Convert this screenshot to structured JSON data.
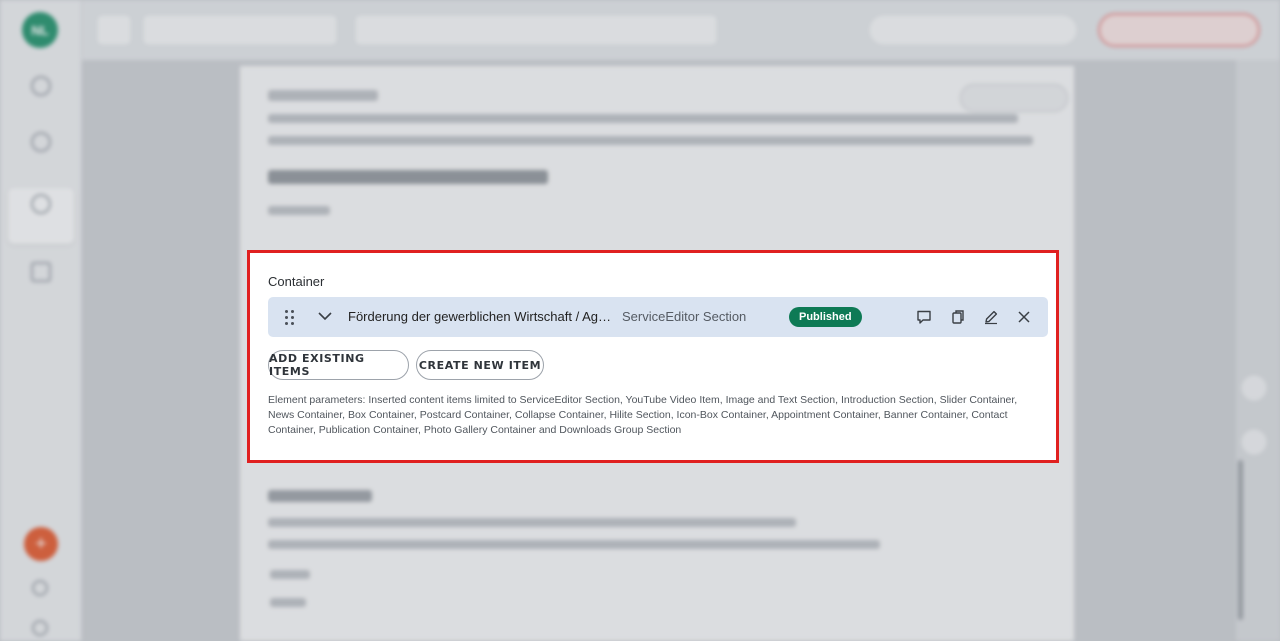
{
  "sidebar": {
    "logo_text": "NL",
    "fab_label": "+"
  },
  "container": {
    "title": "Container",
    "item": {
      "title": "Förderung der gewerblichen Wirtschaft / Agentur für Arbeit",
      "type": "ServiceEditor Section",
      "status": "Published"
    },
    "buttons": {
      "add_existing": "ADD EXISTING ITEMS",
      "create_new": "CREATE NEW ITEM"
    },
    "parameters": "Element parameters: Inserted content items limited to ServiceEditor Section, YouTube Video Item, Image and Text Section, Introduction Section, Slider Container, News Container, Box Container, Postcard Container, Collapse Container, Hilite Section, Icon-Box Container, Appointment Container, Banner Container, Contact Container, Publication Container, Photo Gallery Container and Downloads Group Section"
  },
  "colors": {
    "highlight_border": "#e02020",
    "row_bg": "#d9e3f1",
    "published_badge": "#0e7a55",
    "fab": "#e0582e"
  }
}
